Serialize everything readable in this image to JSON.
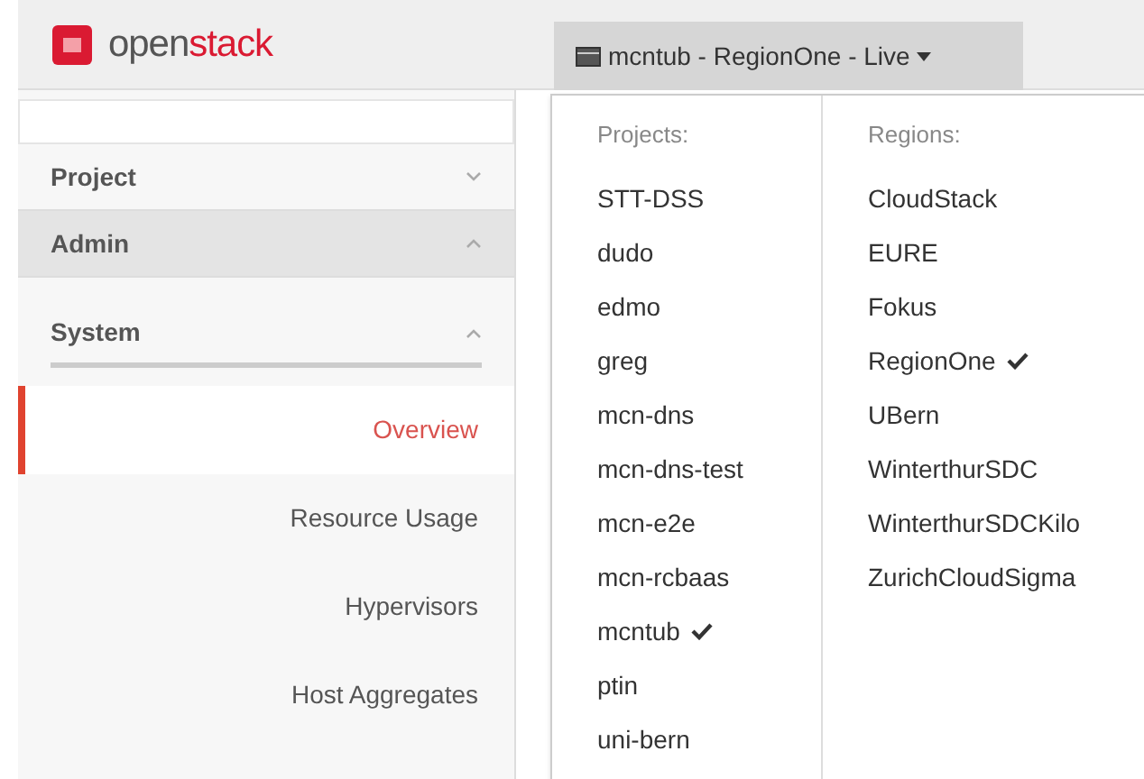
{
  "logo": {
    "parts": [
      "open",
      "stack"
    ]
  },
  "context_menu": {
    "label": "mcntub - RegionOne - Live",
    "expanded": true
  },
  "dropdown": {
    "projects": {
      "heading": "Projects:",
      "items": [
        {
          "label": "STT-DSS",
          "selected": false
        },
        {
          "label": "dudo",
          "selected": false
        },
        {
          "label": "edmo",
          "selected": false
        },
        {
          "label": "greg",
          "selected": false
        },
        {
          "label": "mcn-dns",
          "selected": false
        },
        {
          "label": "mcn-dns-test",
          "selected": false
        },
        {
          "label": "mcn-e2e",
          "selected": false
        },
        {
          "label": "mcn-rcbaas",
          "selected": false
        },
        {
          "label": "mcntub",
          "selected": true
        },
        {
          "label": "ptin",
          "selected": false
        },
        {
          "label": "uni-bern",
          "selected": false
        }
      ]
    },
    "regions": {
      "heading": "Regions:",
      "items": [
        {
          "label": "CloudStack",
          "selected": false
        },
        {
          "label": "EURE",
          "selected": false
        },
        {
          "label": "Fokus",
          "selected": false
        },
        {
          "label": "RegionOne",
          "selected": true
        },
        {
          "label": "UBern",
          "selected": false
        },
        {
          "label": "WinterthurSDC",
          "selected": false
        },
        {
          "label": "WinterthurSDCKilo",
          "selected": false
        },
        {
          "label": "ZurichCloudSigma",
          "selected": false
        }
      ]
    }
  },
  "sidebar": {
    "panels": [
      {
        "label": "Project",
        "expanded": false
      },
      {
        "label": "Admin",
        "expanded": true
      }
    ],
    "section": {
      "label": "System",
      "expanded": true
    },
    "items": [
      {
        "label": "Overview",
        "selected": true
      },
      {
        "label": "Resource Usage",
        "selected": false
      },
      {
        "label": "Hypervisors",
        "selected": false
      },
      {
        "label": "Host Aggregates",
        "selected": false
      }
    ]
  }
}
